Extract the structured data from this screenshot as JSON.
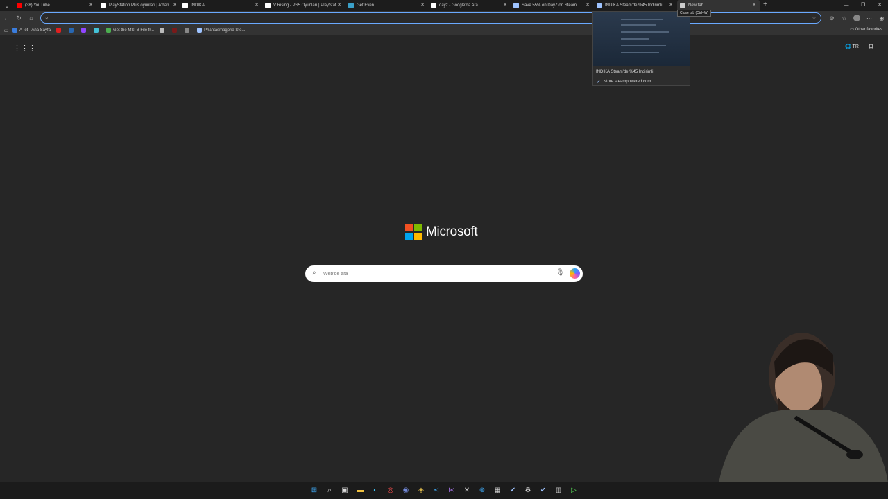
{
  "tabs": [
    {
      "label": "(38) YouTube",
      "color": "#ff0000"
    },
    {
      "label": "PlayStation Plus oyunları | A'dan...",
      "color": "#ffffff"
    },
    {
      "label": "INDIKA",
      "color": "#ffffff"
    },
    {
      "label": "V Rising - PS5 Oyunları | PlayStati...",
      "color": "#ffffff"
    },
    {
      "label": "Get Even",
      "color": "#3aa0c8"
    },
    {
      "label": "dayz - Google'da Ara",
      "color": "#ffffff"
    },
    {
      "label": "Save 55% on DayZ on Steam",
      "color": "#9ec3ff"
    },
    {
      "label": "INDIKA Steam'de %45 İndirimli",
      "color": "#9ec3ff"
    },
    {
      "label": "New tab",
      "color": "#cccccc"
    }
  ],
  "tooltip": "Close tab (Ctrl+W)",
  "preview": {
    "title": "INDIKA Steam'de %45 İndirimli",
    "url": "store.steampowered.com"
  },
  "bookmarks": [
    {
      "label": "A-let - Ana Sayfa",
      "color": "#3b7ddd"
    },
    {
      "label": "",
      "color": "#e02020"
    },
    {
      "label": "",
      "color": "#2867b2"
    },
    {
      "label": "",
      "color": "#9146ff"
    },
    {
      "label": "",
      "color": "#44c2d8"
    },
    {
      "label": "Get the MSI B File fr...",
      "color": "#4caf50"
    },
    {
      "label": "",
      "color": "#bbbbbb"
    },
    {
      "label": "",
      "color": "#7a1a1a"
    },
    {
      "label": "",
      "color": "#888888"
    },
    {
      "label": "Phantasmagoria Ste...",
      "color": "#9ec3ff"
    }
  ],
  "other_favorites": "Other favorites",
  "language": "TR",
  "brand": "Microsoft",
  "search": {
    "placeholder": "Web'de ara"
  },
  "logo_colors": [
    "#f25022",
    "#7fba00",
    "#00a4ef",
    "#ffb900"
  ]
}
